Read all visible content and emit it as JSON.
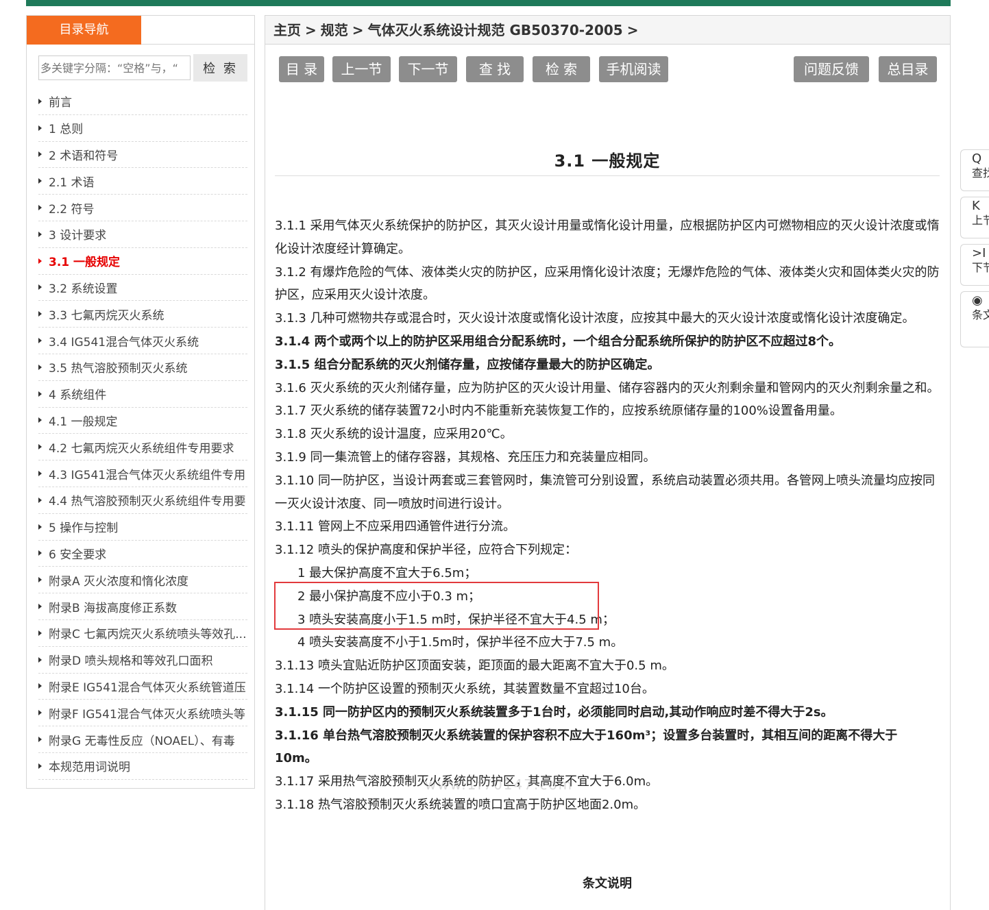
{
  "sidebar": {
    "tab_label": "目录导航",
    "search_placeholder": "多关键字分隔：“空格”与，“",
    "search_button": "检 索",
    "items": [
      {
        "label": "前言"
      },
      {
        "label": "1 总则"
      },
      {
        "label": "2 术语和符号"
      },
      {
        "label": "2.1 术语"
      },
      {
        "label": "2.2 符号"
      },
      {
        "label": "3 设计要求"
      },
      {
        "label": "3.1 一般规定",
        "active": true
      },
      {
        "label": "3.2 系统设置"
      },
      {
        "label": "3.3 七氟丙烷灭火系统"
      },
      {
        "label": "3.4 IG541混合气体灭火系统"
      },
      {
        "label": "3.5 热气溶胶预制灭火系统"
      },
      {
        "label": "4 系统组件"
      },
      {
        "label": "4.1 一般规定"
      },
      {
        "label": "4.2 七氟丙烷灭火系统组件专用要求"
      },
      {
        "label": "4.3 IG541混合气体灭火系统组件专用"
      },
      {
        "label": "4.4 热气溶胶预制灭火系统组件专用要"
      },
      {
        "label": "5 操作与控制"
      },
      {
        "label": "6 安全要求"
      },
      {
        "label": "附录A 灭火浓度和惰化浓度"
      },
      {
        "label": "附录B 海拔高度修正系数"
      },
      {
        "label": "附录C 七氟丙烷灭火系统喷头等效孔..."
      },
      {
        "label": "附录D 喷头规格和等效孔口面积"
      },
      {
        "label": "附录E IG541混合气体灭火系统管道压"
      },
      {
        "label": "附录F IG541混合气体灭火系统喷头等"
      },
      {
        "label": "附录G 无毒性反应（NOAEL）、有毒"
      },
      {
        "label": "本规范用词说明"
      }
    ]
  },
  "breadcrumb": {
    "home": "主页",
    "cat": "规范",
    "doc": "气体灭火系统设计规范 GB50370-2005",
    "sep": ">"
  },
  "toolbar": {
    "toc": "目 录",
    "prev": "上一节",
    "next": "下一节",
    "find": "查 找",
    "search": "检 索",
    "mobile": "手机阅读",
    "feedback": "问题反馈",
    "master": "总目录"
  },
  "section_title": "3.1 一般规定",
  "clauses": [
    {
      "text": "3.1.1 采用气体灭火系统保护的防护区，其灭火设计用量或惰化设计用量，应根据防护区内可燃物相应的灭火设计浓度或惰化设计浓度经计算确定。"
    },
    {
      "text": "3.1.2 有爆炸危险的气体、液体类火灾的防护区，应采用惰化设计浓度；无爆炸危险的气体、液体类火灾和固体类火灾的防护区，应采用灭火设计浓度。"
    },
    {
      "text": "3.1.3 几种可燃物共存或混合时，灭火设计浓度或惰化设计浓度，应按其中最大的灭火设计浓度或惰化设计浓度确定。"
    },
    {
      "text": "3.1.4 两个或两个以上的防护区采用组合分配系统时，一个组合分配系统所保护的防护区不应超过8个。",
      "bold": true
    },
    {
      "text": "3.1.5 组合分配系统的灭火剂储存量，应按储存量最大的防护区确定。",
      "bold": true
    },
    {
      "text": "3.1.6 灭火系统的灭火剂储存量，应为防护区的灭火设计用量、储存容器内的灭火剂剩余量和管网内的灭火剂剩余量之和。"
    },
    {
      "text": "3.1.7 灭火系统的储存装置72小时内不能重新充装恢复工作的，应按系统原储存量的100%设置备用量。"
    },
    {
      "text": "3.1.8 灭火系统的设计温度，应采用20℃。"
    },
    {
      "text": "3.1.9 同一集流管上的储存容器，其规格、充压压力和充装量应相同。"
    },
    {
      "text": "3.1.10 同一防护区，当设计两套或三套管网时，集流管可分别设置，系统启动装置必须共用。各管网上喷头流量均应按同一灭火设计浓度、同一喷放时间进行设计。"
    },
    {
      "text": "3.1.11 管网上不应采用四通管件进行分流。"
    },
    {
      "text": "3.1.12 喷头的保护高度和保护半径，应符合下列规定："
    },
    {
      "text": "1 最大保护高度不宜大于6.5m；",
      "indent": true
    },
    {
      "text": "2 最小保护高度不应小于0.3 m；",
      "indent": true
    },
    {
      "text": "3 喷头安装高度小于1.5 m时，保护半径不宜大于4.5 m；",
      "indent": true
    },
    {
      "text": "4 喷头安装高度不小于1.5m时，保护半径不应大于7.5 m。",
      "indent": true
    },
    {
      "text": "3.1.13 喷头宜贴近防护区顶面安装，距顶面的最大距离不宜大于0.5 m。"
    },
    {
      "text": "3.1.14 一个防护区设置的预制灭火系统，其装置数量不宜超过10台。"
    },
    {
      "text": "3.1.15 同一防护区内的预制灭火系统装置多于1台时，必须能同时启动,其动作响应时差不得大于2s。",
      "bold": true
    },
    {
      "text": "3.1.16 单台热气溶胶预制灭火系统装置的保护容积不应大于160m³；设置多台装置时，其相互间的距离不得大于10m。",
      "bold": true
    },
    {
      "text": "3.1.17 采用热气溶胶预制灭火系统的防护区，其高度不宜大于6.0m。"
    },
    {
      "text": "3.1.18 热气溶胶预制灭火系统装置的喷口宜高于防护区地面2.0m。"
    }
  ],
  "watermark": "www.1f70147.com",
  "note_title": "条文说明",
  "float_tools": [
    {
      "icon": "Q",
      "label": "查找"
    },
    {
      "icon": "K",
      "label": "上节"
    },
    {
      "icon": ">I",
      "label": "下节"
    },
    {
      "icon": "◉",
      "label": "条文说明"
    }
  ],
  "colors": {
    "accent_orange": "#f46b1f",
    "topbar_green": "#1f7a5a",
    "active_red": "#e60000",
    "button_gray": "#8d8d8d",
    "highlight_red": "#e2393c"
  }
}
